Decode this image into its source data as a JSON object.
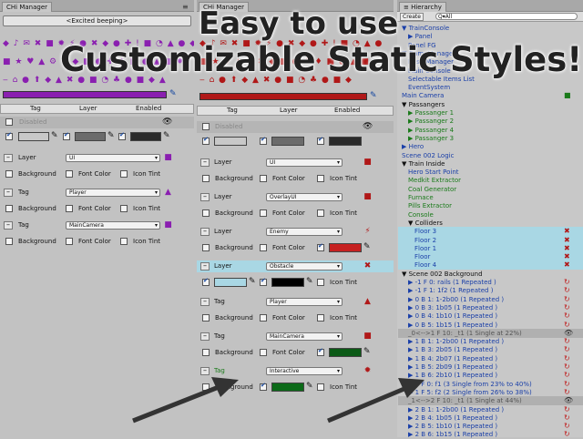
{
  "left": {
    "tab": "CHi Manager",
    "top_button": "<Excited beeping>",
    "header": {
      "tag": "Tag",
      "layer": "Layer",
      "enabled": "Enabled"
    },
    "disabled_label": "Disabled",
    "rows": [
      {
        "kind": "Layer",
        "value": "UI",
        "icon": "■",
        "color": "#8a1fb0",
        "bg": "Background",
        "fc": "Font Color",
        "it": "Icon Tint"
      },
      {
        "kind": "Tag",
        "value": "Player",
        "icon": "▲",
        "color": "#8a1fb0",
        "bg": "Background",
        "fc": "Font Color",
        "it": "Icon Tint"
      },
      {
        "kind": "Tag",
        "value": "MainCamera",
        "icon": "■",
        "color": "#8a1fb0",
        "bg": "Background",
        "fc": "Font Color",
        "it": "Icon Tint"
      }
    ]
  },
  "mid": {
    "tab": "CHi Manager",
    "header": {
      "tag": "Tag",
      "layer": "Layer",
      "enabled": "Enabled"
    },
    "disabled_label": "Disabled",
    "rows": [
      {
        "kind": "Layer",
        "value": "UI",
        "bg": "Background",
        "fc": "Font Color",
        "it": "Icon Tint",
        "icon": "■",
        "color": "#b01818"
      },
      {
        "kind": "Layer",
        "value": "OverlayUI",
        "bg": "Background",
        "fc": "Font Color",
        "it": "Icon Tint",
        "icon": "■",
        "color": "#b01818"
      },
      {
        "kind": "Layer",
        "value": "Enemy",
        "bg": "Background",
        "fc": "Font Color",
        "it": "Icon Tint",
        "icon": "⚡",
        "color": "#b01818"
      },
      {
        "kind": "Layer",
        "value": "Obstacle",
        "bg": "Background",
        "fc": "Font Color",
        "it": "Icon Tint",
        "icon": "✖",
        "color": "#b01818"
      },
      {
        "kind": "Tag",
        "value": "Player",
        "bg": "Background",
        "fc": "Font Color",
        "it": "Icon Tint",
        "icon": "▲",
        "color": "#b01818"
      },
      {
        "kind": "Tag",
        "value": "MainCamera",
        "bg": "Background",
        "fc": "Font Color",
        "it": "Icon Tint",
        "icon": "■",
        "color": "#b01818"
      },
      {
        "kind": "Tag",
        "value": "Interactive",
        "bg": "Background",
        "fc": "Font Color",
        "it": "Icon Tint",
        "icon": "✹",
        "color": "#b01818"
      }
    ]
  },
  "right": {
    "tab": "Hierarchy",
    "create": "Create",
    "search": "Q▾All",
    "items": [
      {
        "t": "▼ TrainConsole",
        "c": "#1a3fa8",
        "i": 0
      },
      {
        "t": "▶ Panel",
        "c": "#1a3fa8",
        "i": 1
      },
      {
        "t": "Panel FG",
        "c": "#1a3fa8",
        "i": 1
      },
      {
        "t": "▼ GameManager",
        "c": "#1a3fa8",
        "i": 0
      },
      {
        "t": "Base Manager",
        "c": "#1a3fa8",
        "i": 1
      },
      {
        "t": "Main Console",
        "c": "#1a3fa8",
        "i": 1
      },
      {
        "t": "Selectable Items List",
        "c": "#1a3fa8",
        "i": 1
      },
      {
        "t": "EventSystem",
        "c": "#1a3fa8",
        "i": 1
      },
      {
        "t": "Main Camera",
        "c": "#1a3fa8",
        "i": 0
      },
      {
        "t": "▼ Passangers",
        "c": "#111",
        "i": 0
      },
      {
        "t": "▶ Passanger 1",
        "c": "#1a7a1a",
        "i": 1
      },
      {
        "t": "▶ Passanger 2",
        "c": "#1a7a1a",
        "i": 1
      },
      {
        "t": "▶ Passanger 4",
        "c": "#1a7a1a",
        "i": 1
      },
      {
        "t": "▶ Passanger 3",
        "c": "#1a7a1a",
        "i": 1
      },
      {
        "t": "▶ Hero",
        "c": "#1a3fa8",
        "i": 0
      },
      {
        "t": "Scene 002 Logic",
        "c": "#1a3fa8",
        "i": 0
      },
      {
        "t": "▼ Train Inside",
        "c": "#111",
        "i": 0
      },
      {
        "t": "Hero Start Point",
        "c": "#1a3fa8",
        "i": 1
      },
      {
        "t": "Medkit Extractor",
        "c": "#1a7a1a",
        "i": 1
      },
      {
        "t": "Coal Generator",
        "c": "#1a7a1a",
        "i": 1
      },
      {
        "t": "Furnace",
        "c": "#1a7a1a",
        "i": 1
      },
      {
        "t": "Pills Extractor",
        "c": "#1a7a1a",
        "i": 1
      },
      {
        "t": "Console",
        "c": "#1a7a1a",
        "i": 1
      },
      {
        "t": "▼ Colliders",
        "c": "#111",
        "i": 1
      },
      {
        "t": "Floor 3",
        "c": "#1a3fa8",
        "i": 2,
        "hl": true
      },
      {
        "t": "Floor 2",
        "c": "#1a3fa8",
        "i": 2,
        "hl": true
      },
      {
        "t": "Floor 1",
        "c": "#1a3fa8",
        "i": 2,
        "hl": true
      },
      {
        "t": "Floor",
        "c": "#1a3fa8",
        "i": 2,
        "hl": true
      },
      {
        "t": "Floor 4",
        "c": "#1a3fa8",
        "i": 2,
        "hl": true
      },
      {
        "t": "▼ Scene 002 Background",
        "c": "#111",
        "i": 0
      },
      {
        "t": "▶ -1 F 0: rails (1 Repeated )",
        "c": "#1a3fa8",
        "i": 1
      },
      {
        "t": "▶ -1 F 1: 1f2 (1 Repeated )",
        "c": "#1a3fa8",
        "i": 1
      },
      {
        "t": "▶ 0 B 1: 1-2b00 (1 Repeated )",
        "c": "#1a3fa8",
        "i": 1
      },
      {
        "t": "▶ 0 B 3: 1b05 (1 Repeated )",
        "c": "#1a3fa8",
        "i": 1
      },
      {
        "t": "▶ 0 B 4: 1b10 (1 Repeated )",
        "c": "#1a3fa8",
        "i": 1
      },
      {
        "t": "▶ 0 B 5: 1b15 (1 Repeated )",
        "c": "#1a3fa8",
        "i": 1
      },
      {
        "t": "_0<-->1 F 10: _t1 (1 Single at 22%)",
        "c": "#555",
        "i": 1,
        "sep": true
      },
      {
        "t": "▶ 1 B 1: 1-2b00 (1 Repeated )",
        "c": "#1a3fa8",
        "i": 1
      },
      {
        "t": "▶ 1 B 3: 2b05 (1 Repeated )",
        "c": "#1a3fa8",
        "i": 1
      },
      {
        "t": "▶ 1 B 4: 2b07 (1 Repeated )",
        "c": "#1a3fa8",
        "i": 1
      },
      {
        "t": "▶ 1 B 5: 2b09 (1 Repeated )",
        "c": "#1a3fa8",
        "i": 1
      },
      {
        "t": "▶ 1 B 6: 2b10 (1 Repeated )",
        "c": "#1a3fa8",
        "i": 1
      },
      {
        "t": "▶ 1 F 0: f1 (3 Single from 23% to 40%)",
        "c": "#1a3fa8",
        "i": 1
      },
      {
        "t": "▶ 1 F 5: f2 (2 Single from 26% to 38%)",
        "c": "#1a3fa8",
        "i": 1
      },
      {
        "t": "_1<-->2 F 10: _t1 (1 Single at 44%)",
        "c": "#555",
        "i": 1,
        "sep": true
      },
      {
        "t": "▶ 2 B 1: 1-2b00 (1 Repeated )",
        "c": "#1a3fa8",
        "i": 1
      },
      {
        "t": "▶ 2 B 4: 1b05 (1 Repeated )",
        "c": "#1a3fa8",
        "i": 1
      },
      {
        "t": "▶ 2 B 5: 1b10 (1 Repeated )",
        "c": "#1a3fa8",
        "i": 1
      },
      {
        "t": "▶ 2 B 6: 1b15 (1 Repeated )",
        "c": "#1a3fa8",
        "i": 1
      }
    ]
  },
  "overlay": {
    "line1": "Easy to use",
    "line2": "Customizable Static Styles!"
  }
}
